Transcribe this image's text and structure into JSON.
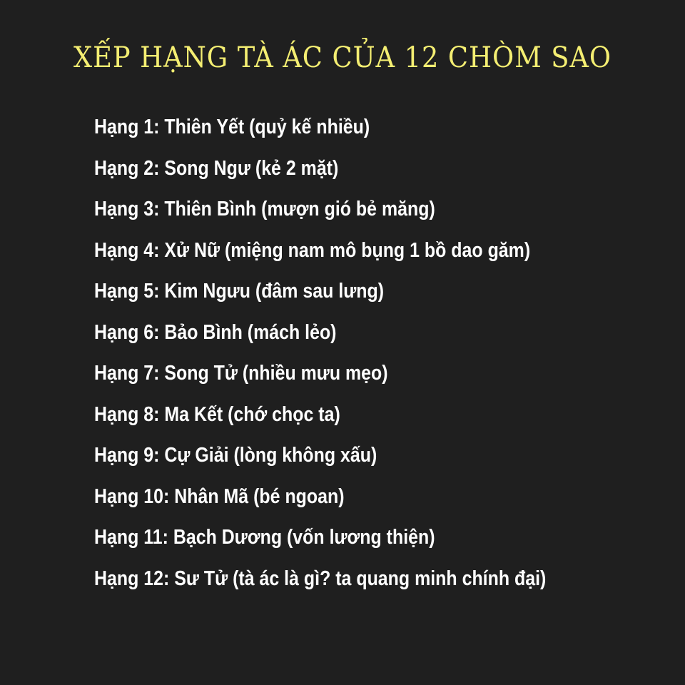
{
  "title": "XẾP HẠNG TÀ ÁC CỦA 12 CHÒM SAO",
  "colors": {
    "background": "#1f1f1f",
    "title": "#f4ee72",
    "text": "#ffffff"
  },
  "rankings": [
    "Hạng 1: Thiên Yết (quỷ kế nhiều)",
    "Hạng 2: Song Ngư (kẻ 2 mặt)",
    "Hạng 3: Thiên Bình (mượn gió bẻ măng)",
    "Hạng 4: Xử Nữ (miệng nam mô bụng 1 bồ dao găm)",
    "Hạng 5: Kim Ngưu (đâm sau lưng)",
    "Hạng 6: Bảo Bình (mách lẻo)",
    "Hạng 7: Song Tử (nhiều mưu mẹo)",
    "Hạng 8: Ma Kết (chớ chọc ta)",
    "Hạng 9: Cự Giải (lòng không xấu)",
    "Hạng 10: Nhân Mã (bé ngoan)",
    "Hạng 11: Bạch Dương (vốn lương thiện)",
    "Hạng 12: Sư Tử (tà ác là gì? ta quang minh chính đại)"
  ]
}
